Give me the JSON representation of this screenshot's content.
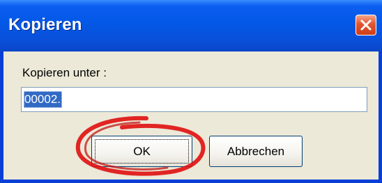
{
  "dialog": {
    "title": "Kopieren",
    "label": "Kopieren unter :",
    "input_value": "00002."
  },
  "buttons": {
    "ok_label": "OK",
    "cancel_label": "Abbrechen"
  },
  "icons": {
    "close": "close-icon"
  },
  "colors": {
    "titlebar": "#0358e6",
    "dialog_bg": "#ece9d8",
    "close_button": "#e2562f",
    "selection": "#316ac5",
    "annotation_circle": "#e01010"
  }
}
